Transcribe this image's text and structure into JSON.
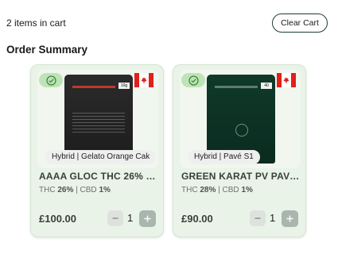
{
  "header": {
    "cart_count_text": "2 items in cart",
    "clear_cart_label": "Clear Cart"
  },
  "summary": {
    "title": "Order Summary"
  },
  "products": [
    {
      "variety_label": "Hybrid | Gelato Orange Cak",
      "name": "AAAA GLOC THC 26% C...",
      "thc": "26%",
      "cbd": "1%",
      "price": "£100.00",
      "quantity": "1",
      "pouch_label": "10g"
    },
    {
      "variety_label": "Hybrid | Pavé S1",
      "name": "GREEN KARAT PV PAVE ...",
      "thc": "28%",
      "cbd": "1%",
      "price": "£90.00",
      "quantity": "1",
      "pouch_label": "40"
    }
  ],
  "labels": {
    "thc": "THC",
    "cbd": "CBD",
    "sep": "|"
  },
  "icons": {
    "check": "check-circle-icon",
    "flag": "canada-flag-icon",
    "minus": "minus-icon",
    "plus": "plus-icon"
  },
  "colors": {
    "card_bg": "#e9f3e8",
    "badge_bg": "#bfe3b8",
    "check_green": "#3f8a3a",
    "flag_red": "#e0201b"
  }
}
